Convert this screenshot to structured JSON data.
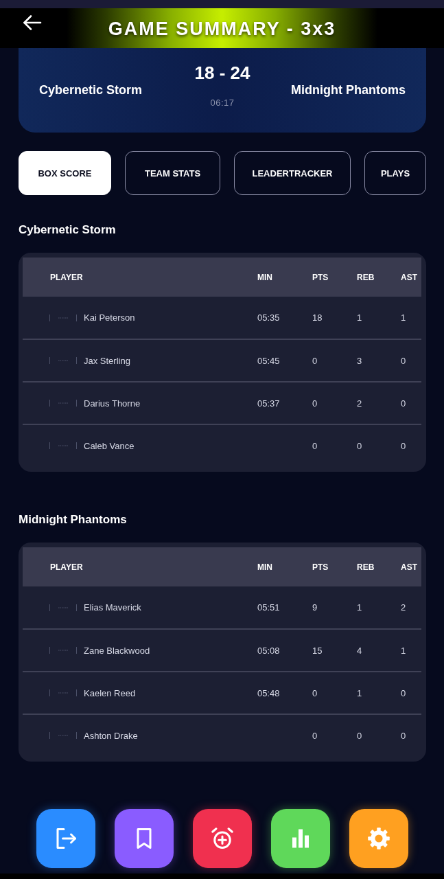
{
  "header": {
    "title": "GAME SUMMARY - 3x3"
  },
  "scoreboard": {
    "home_team": "Cybernetic Storm",
    "score": "18 - 24",
    "clock": "06:17",
    "away_team": "Midnight Phantoms"
  },
  "tabs": [
    {
      "label": "BOX SCORE",
      "selected": true
    },
    {
      "label": "TEAM STATS",
      "selected": false
    },
    {
      "label": "LEADERTRACKER",
      "selected": false
    },
    {
      "label": "PLAYS",
      "selected": false
    }
  ],
  "box_scores": [
    {
      "team": "Cybernetic Storm",
      "columns": [
        "PLAYER",
        "MIN",
        "PTS",
        "REB",
        "AST"
      ],
      "rows": [
        {
          "player": "Kai Peterson",
          "min": "05:35",
          "pts": "18",
          "reb": "1",
          "ast": "1"
        },
        {
          "player": "Jax Sterling",
          "min": "05:45",
          "pts": "0",
          "reb": "3",
          "ast": "0"
        },
        {
          "player": "Darius Thorne",
          "min": "05:37",
          "pts": "0",
          "reb": "2",
          "ast": "0"
        },
        {
          "player": "Caleb Vance",
          "pts": "0",
          "reb": "0",
          "ast": "0"
        }
      ]
    },
    {
      "team": "Midnight Phantoms",
      "columns": [
        "PLAYER",
        "MIN",
        "PTS",
        "REB",
        "AST"
      ],
      "rows": [
        {
          "player": "Elias Maverick",
          "min": "05:51",
          "pts": "9",
          "reb": "1",
          "ast": "2"
        },
        {
          "player": "Zane Blackwood",
          "min": "05:08",
          "pts": "15",
          "reb": "4",
          "ast": "1"
        },
        {
          "player": "Kaelen Reed",
          "min": "05:48",
          "pts": "0",
          "reb": "1",
          "ast": "0"
        },
        {
          "player": "Ashton Drake",
          "pts": "0",
          "reb": "0",
          "ast": "0"
        }
      ]
    }
  ],
  "bottom_nav": [
    {
      "kind": "exit",
      "color": "#2a8cff"
    },
    {
      "kind": "bookmark",
      "color": "#8a5cff"
    },
    {
      "kind": "alarm",
      "color": "#f0304f"
    },
    {
      "kind": "chart",
      "color": "#5fd85a"
    },
    {
      "kind": "settings",
      "color": "#ffa020"
    }
  ]
}
